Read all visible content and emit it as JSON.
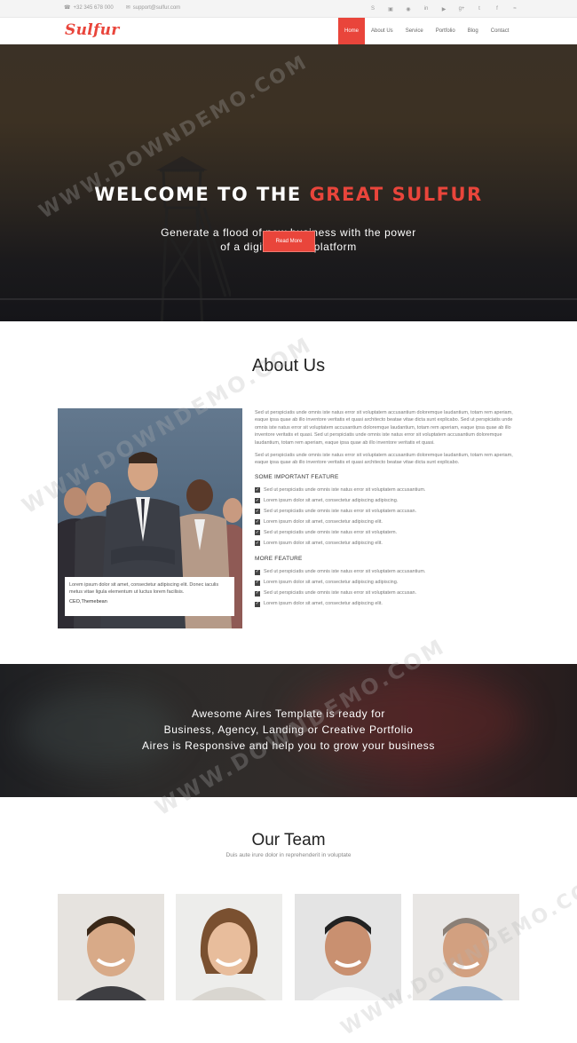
{
  "topbar": {
    "phone": "+32 345 678 000",
    "email": "support@sulfur.com",
    "social_icons": [
      "skype-icon",
      "instagram-icon",
      "dribbble-icon",
      "linkedin-icon",
      "youtube-icon",
      "google-plus-icon",
      "twitter-icon",
      "facebook-icon",
      "rss-icon"
    ]
  },
  "brand": {
    "logo": "Sulfur",
    "accent": "#e9453b"
  },
  "nav": [
    "Home",
    "About Us",
    "Service",
    "Portfolio",
    "Blog",
    "Contact"
  ],
  "hero": {
    "title_prefix": "WELCOME TO THE",
    "title_highlight": "GREAT SULFUR",
    "subtitle": "Generate a flood of new business with the power of a digital media platform",
    "button": "Read More"
  },
  "about": {
    "title": "About Us",
    "para1": "Sed ut perspiciatis unde omnis iste natus error sit voluptatem accusantium doloremque laudantium, totam rem aperiam, eaque ipsa quae ab illo inventore veritatis et quasi architecto beatae vitae dicta sunt explicabo. Sed ut perspiciatis unde omnis iste natus error sit voluptatem accusantium doloremque laudantium, totam rem aperiam, eaque ipsa quae ab illo inventore veritatis et quasi. Sed ut perspiciatis unde omnis iste natus error sit voluptatem accusantium doloremque laudantium, totam rem aperiam, eaque ipsa quae ab illo inventore veritatis et quasi.",
    "para2": "Sed ut perspiciatis unde omnis iste natus error sit voluptatem accusantium doloremque laudantium, totam rem aperiam, eaque ipsa quae ab illo inventore veritatis et quasi architecto beatae vitae dicta sunt explicabo.",
    "feature_title_1": "SOME IMPORTANT FEATURE",
    "features_1": [
      "Sed ut perspiciatis unde omnis iste natus error sit voluptatem accusantium.",
      "Lorem ipsum dolor sit amet, consectetur adipiscing adipiscing.",
      "Sed ut perspiciatis unde omnis iste natus error sit voluptatem accusan.",
      "Lorem ipsum dolor sit amet, consectetur adipiscing elit.",
      "Sed ut perspiciatis unde omnis iste natus error sit voluptatem.",
      "Lorem ipsum dolor sit amet, consectetur adipiscing elit."
    ],
    "feature_title_2": "MORE FEATURE",
    "features_2": [
      "Sed ut perspiciatis unde omnis iste natus error sit voluptatem accusantium.",
      "Lorem ipsum dolor sit amet, consectetur adipiscing adipiscing.",
      "Sed ut perspiciatis unde omnis iste natus error sit voluptatem accusan.",
      "Lorem ipsum dolor sit amet, consectetur adipiscing elit."
    ],
    "quote": "Lorem ipsum dolor sit amet, consectetur adipiscing elit. Donec iaculis metus vitae ligula elementum ut luctus lorem facilisis.",
    "quote_author": "CEO,Themebean"
  },
  "promo": {
    "line1": "Awesome Aires Template is ready for",
    "line2": "Business, Agency, Landing or Creative Portfolio",
    "line3": "Aires is Responsive and help you to grow your business"
  },
  "team": {
    "title": "Our Team",
    "subtitle": "Duis aute irure dolor in reprehenderit in voluptate"
  },
  "watermark": "WWW.DOWNDEMO.COM"
}
